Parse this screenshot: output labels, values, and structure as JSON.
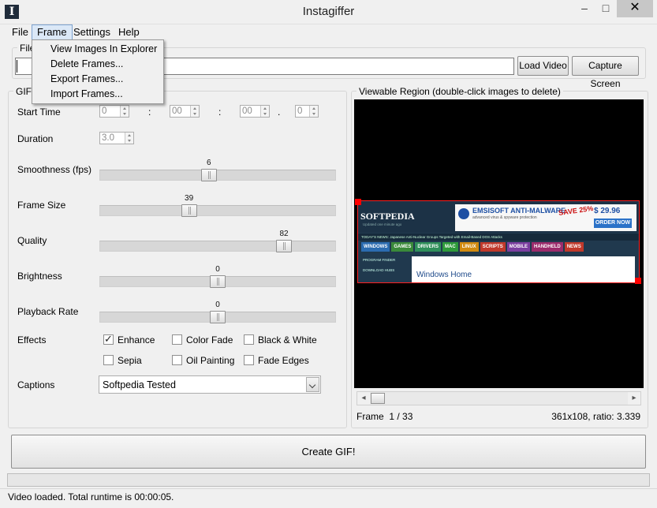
{
  "window": {
    "title": "Instagiffer",
    "minimize": "–",
    "maximize": "□",
    "close": "✕",
    "icon_glyph": "I"
  },
  "menubar": {
    "items": [
      "File",
      "Frame",
      "Settings",
      "Help"
    ]
  },
  "frame_menu": {
    "items": [
      "View Images In Explorer",
      "Delete Frames...",
      "Export Frames...",
      "Import Frames..."
    ]
  },
  "file_group": {
    "label": "File",
    "path_value": "",
    "load_video": "Load Video",
    "capture_screen": "Capture Screen"
  },
  "gif_group": {
    "label": "GIF",
    "start_time": {
      "label": "Start Time",
      "h": "0",
      "m": "00",
      "s": "00",
      "ms": "0",
      "sep1": ":",
      "sep2": ":",
      "sep3": "."
    },
    "duration": {
      "label": "Duration",
      "value": "3.0"
    },
    "smoothness": {
      "label": "Smoothness (fps)",
      "value": "6",
      "fraction": 0.46
    },
    "frame_size": {
      "label": "Frame Size",
      "value": "39",
      "fraction": 0.37
    },
    "quality": {
      "label": "Quality",
      "value": "82",
      "fraction": 0.8
    },
    "brightness": {
      "label": "Brightness",
      "value": "0",
      "fraction": 0.5
    },
    "playback_rate": {
      "label": "Playback Rate",
      "value": "0",
      "fraction": 0.5
    },
    "effects": {
      "label": "Effects",
      "items": [
        {
          "name": "Enhance",
          "checked": true
        },
        {
          "name": "Color Fade",
          "checked": false
        },
        {
          "name": "Black & White",
          "checked": false
        },
        {
          "name": "Sepia",
          "checked": false
        },
        {
          "name": "Oil Painting",
          "checked": false
        },
        {
          "name": "Fade Edges",
          "checked": false
        }
      ]
    },
    "captions": {
      "label": "Captions",
      "value": "Softpedia Tested"
    }
  },
  "view_group": {
    "label": "Viewable Region (double-click images to delete)",
    "frame_label": "Frame",
    "frame_counter": "1 / 33",
    "dims": "361x108, ratio: 3.339",
    "scroll_fraction": 0.0,
    "preview": {
      "logo": "SOFTPEDIA",
      "logo_sub": "Updated one minute ago",
      "ad_title": "EMSISOFT ANTI-MALWARE",
      "ad_sub": "advanced virus & spyware protection",
      "ad_save": "SAVE 25%",
      "ad_price": "$ 29.96",
      "ad_order": "ORDER NOW",
      "news": "TODAY'S NEWS:   Japanese Anti-Nuclear Groups Targeted with Email-Based DOS Attacks",
      "tabs": [
        {
          "label": "WINDOWS",
          "color": "#2b6cb0"
        },
        {
          "label": "GAMES",
          "color": "#3a8a3a"
        },
        {
          "label": "DRIVERS",
          "color": "#2f8f5a"
        },
        {
          "label": "MAC",
          "color": "#2e9a3a"
        },
        {
          "label": "LINUX",
          "color": "#d08a10"
        },
        {
          "label": "SCRIPTS",
          "color": "#c0392b"
        },
        {
          "label": "MOBILE",
          "color": "#7b3fa0"
        },
        {
          "label": "HANDHELD",
          "color": "#9b2b6b"
        },
        {
          "label": "NEWS",
          "color": "#c0392b"
        }
      ],
      "left_links": "PROGRAM FINDER",
      "left_links2": "DOWNLOAD HUBS",
      "content_title": "Windows Home"
    }
  },
  "create_gif": "Create GIF!",
  "status": "Video loaded. Total runtime is 00:00:05."
}
